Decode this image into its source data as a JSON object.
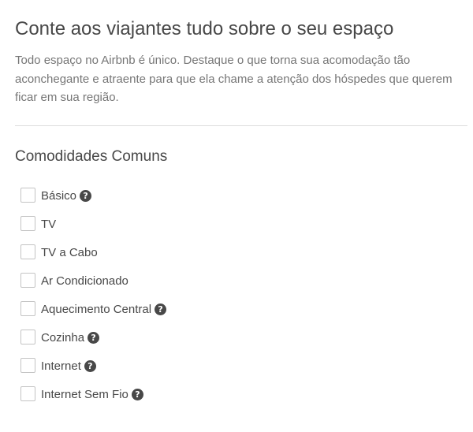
{
  "header": {
    "title": "Conte aos viajantes tudo sobre o seu espaço",
    "description": "Todo espaço no Airbnb é único. Destaque o que torna sua acomodação tão aconchegante e atraente para que ela chame a atenção dos hóspedes que querem ficar em sua região."
  },
  "amenities": {
    "section_title": "Comodidades Comuns",
    "help_glyph": "?",
    "items": [
      {
        "label": "Básico",
        "checked": false,
        "has_help": true
      },
      {
        "label": "TV",
        "checked": false,
        "has_help": false
      },
      {
        "label": "TV a Cabo",
        "checked": false,
        "has_help": false
      },
      {
        "label": "Ar Condicionado",
        "checked": false,
        "has_help": false
      },
      {
        "label": "Aquecimento Central",
        "checked": false,
        "has_help": true
      },
      {
        "label": "Cozinha",
        "checked": false,
        "has_help": true
      },
      {
        "label": "Internet",
        "checked": false,
        "has_help": true
      },
      {
        "label": "Internet Sem Fio",
        "checked": false,
        "has_help": true
      }
    ]
  },
  "colors": {
    "text": "#484848",
    "muted_text": "#767676",
    "divider": "#dddddd",
    "checkbox_border": "#c4c4c4",
    "help_icon_bg": "#484848"
  },
  "icons": {
    "help": "question-circle-icon"
  }
}
